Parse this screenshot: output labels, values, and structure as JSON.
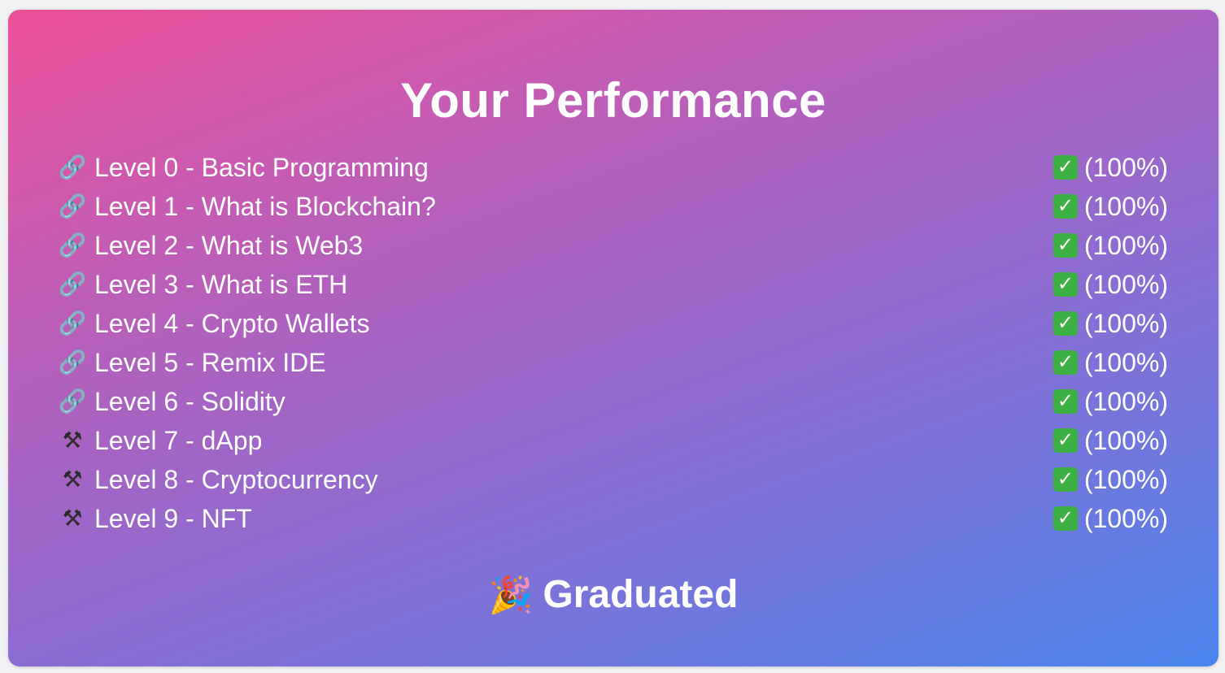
{
  "title": "Your Performance",
  "levels": [
    {
      "icon": "link-icon",
      "label": "Level 0 - Basic Programming",
      "score": "(100%)"
    },
    {
      "icon": "link-icon",
      "label": "Level 1 - What is Blockchain?",
      "score": "(100%)"
    },
    {
      "icon": "link-icon",
      "label": "Level 2 - What is Web3",
      "score": "(100%)"
    },
    {
      "icon": "link-icon",
      "label": "Level 3 - What is ETH",
      "score": "(100%)"
    },
    {
      "icon": "link-icon",
      "label": "Level 4 - Crypto Wallets",
      "score": "(100%)"
    },
    {
      "icon": "link-icon",
      "label": "Level 5 - Remix IDE",
      "score": "(100%)"
    },
    {
      "icon": "link-icon",
      "label": "Level 6 - Solidity",
      "score": "(100%)"
    },
    {
      "icon": "hammer-pick-icon",
      "label": "Level 7 - dApp",
      "score": "(100%)"
    },
    {
      "icon": "hammer-pick-icon",
      "label": "Level 8 - Cryptocurrency",
      "score": "(100%)"
    },
    {
      "icon": "hammer-pick-icon",
      "label": "Level 9 - NFT",
      "score": "(100%)"
    }
  ],
  "status_icon": "check-mark-icon",
  "footer": {
    "icon": "party-popper-icon",
    "label": "Graduated"
  },
  "colors": {
    "gradient_start": "#ec4f97",
    "gradient_end": "#4a84ee",
    "check_green": "#3cb043",
    "text": "#ffffff"
  }
}
